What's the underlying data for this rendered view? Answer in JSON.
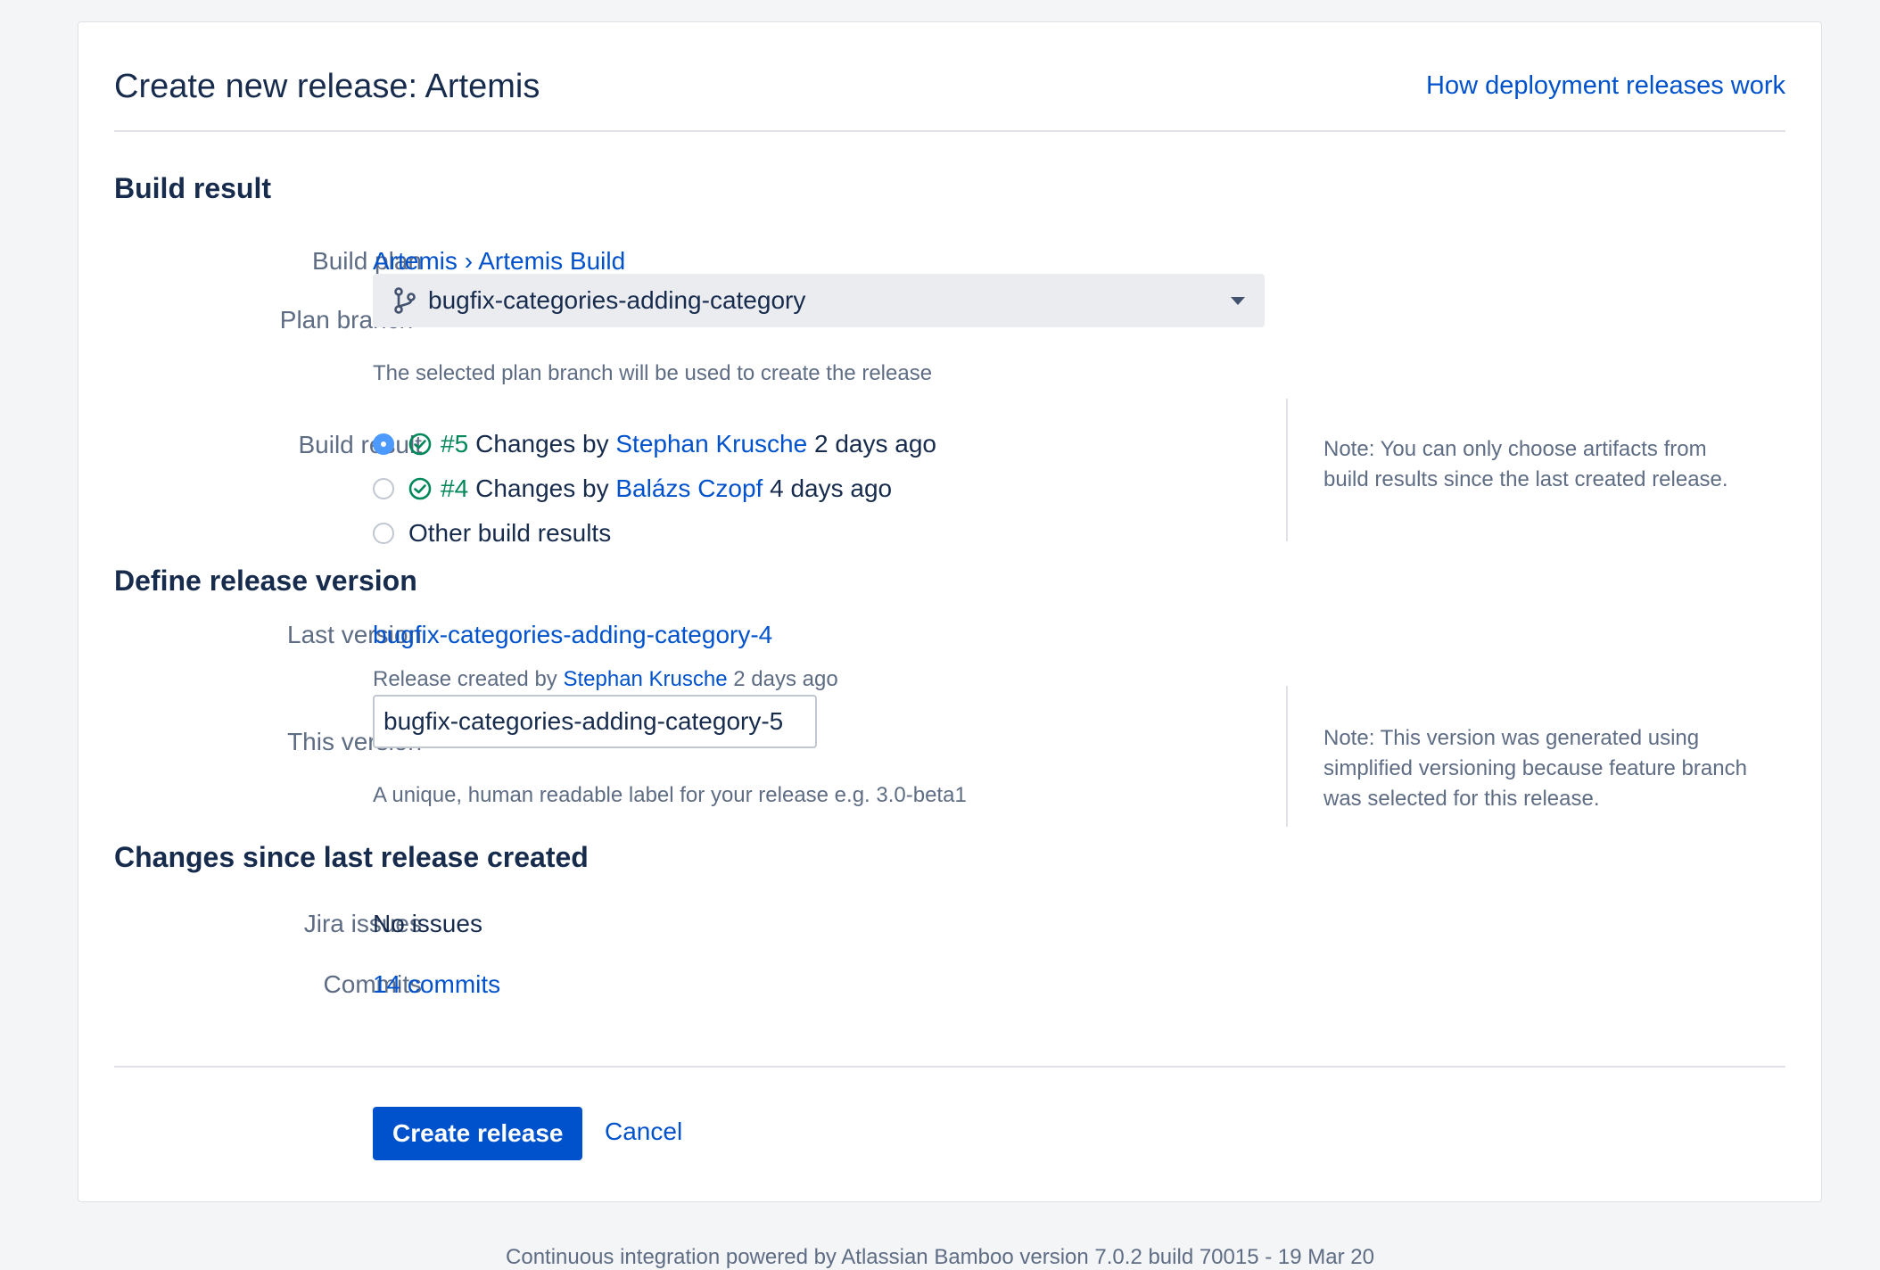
{
  "header": {
    "title": "Create new release: Artemis",
    "help_link": "How deployment releases work"
  },
  "build_result_section": {
    "title": "Build result",
    "build_plan": {
      "label": "Build plan",
      "project": "Artemis",
      "separator": "›",
      "plan": "Artemis Build"
    },
    "plan_branch": {
      "label": "Plan branch",
      "required_mark": "*",
      "selected": "bugfix-categories-adding-category",
      "description": "The selected plan branch will be used to create the release"
    },
    "build_result": {
      "label": "Build result",
      "options": [
        {
          "number": "#5",
          "text": "Changes by",
          "author": "Stephan Krusche",
          "time": "2 days ago",
          "selected": true
        },
        {
          "number": "#4",
          "text": "Changes by",
          "author": "Balázs Czopf",
          "time": "4 days ago",
          "selected": false
        },
        {
          "text": "Other build results",
          "selected": false
        }
      ],
      "note": "Note: You can only choose artifacts from build results since the last created release."
    }
  },
  "release_version_section": {
    "title": "Define release version",
    "last_version": {
      "label": "Last version",
      "value": "bugfix-categories-adding-category-4",
      "created_prefix": "Release created by",
      "created_by": "Stephan Krusche",
      "created_time": "2 days ago"
    },
    "this_version": {
      "label": "This version",
      "value": "bugfix-categories-adding-category-5",
      "description": "A unique, human readable label for your release e.g. 3.0-beta1",
      "note": "Note: This version was generated using simplified versioning because feature branch was selected for this release."
    }
  },
  "changes_section": {
    "title": "Changes since last release created",
    "jira": {
      "label": "Jira issues",
      "value": "No issues"
    },
    "commits": {
      "label": "Commits",
      "value": "14 commits"
    }
  },
  "actions": {
    "create_label": "Create release",
    "cancel_label": "Cancel"
  },
  "footer": {
    "text": "Continuous integration powered by Atlassian Bamboo version 7.0.2 build 70015 - 19 Mar 20"
  },
  "colors": {
    "primary": "#0052cc",
    "success": "#00875a",
    "required": "#de350b",
    "radio_selected": "#4c9aff"
  },
  "icons": {
    "branch": "branch-icon",
    "success": "check-circle-icon",
    "dropdown": "chevron-down-icon"
  }
}
